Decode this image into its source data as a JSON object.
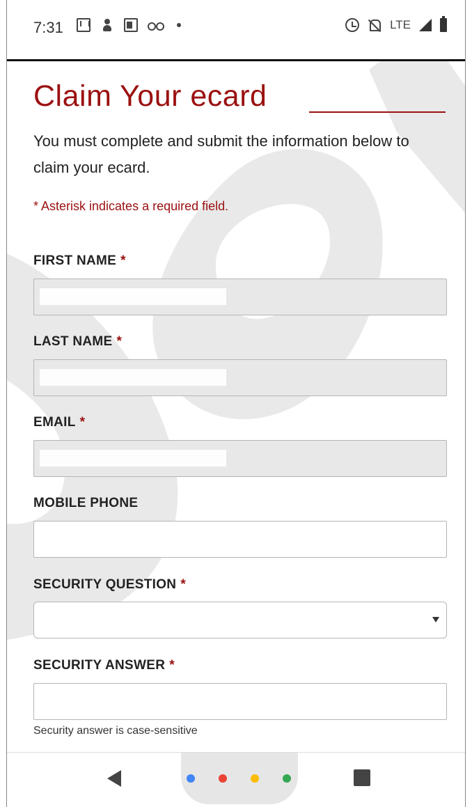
{
  "status_bar": {
    "time": "7:31",
    "network": "LTE",
    "left_icons": [
      "gmail-icon",
      "person-icon",
      "card-icon",
      "voicemail-icon",
      "dot-icon"
    ],
    "right_icons": [
      "alarm-icon",
      "bell-off-icon",
      "signal-icon",
      "battery-icon"
    ]
  },
  "page": {
    "title": "Claim Your ecard",
    "intro": "You must complete and submit the information below to claim your ecard.",
    "required_note": "* Asterisk indicates a required field."
  },
  "form": {
    "first_name": {
      "label": "FIRST NAME",
      "required_mark": "*",
      "value": ""
    },
    "last_name": {
      "label": "LAST NAME",
      "required_mark": "*",
      "value": ""
    },
    "email": {
      "label": "EMAIL",
      "required_mark": "*",
      "value": ""
    },
    "mobile_phone": {
      "label": "MOBILE PHONE",
      "value": ""
    },
    "security_question": {
      "label": "SECURITY QUESTION",
      "required_mark": "*",
      "value": ""
    },
    "security_answer": {
      "label": "SECURITY ANSWER",
      "required_mark": "*",
      "value": "",
      "hint": "Security answer is case-sensitive"
    }
  },
  "nav_bar": {
    "buttons": [
      "back-icon",
      "assistant-dots-icon",
      "recents-icon"
    ],
    "dot_colors": [
      "#4285f4",
      "#ea4335",
      "#fbbc05",
      "#34a853"
    ]
  },
  "colors": {
    "accent": "#9b1010",
    "filled_field": "#e8e8e8"
  }
}
